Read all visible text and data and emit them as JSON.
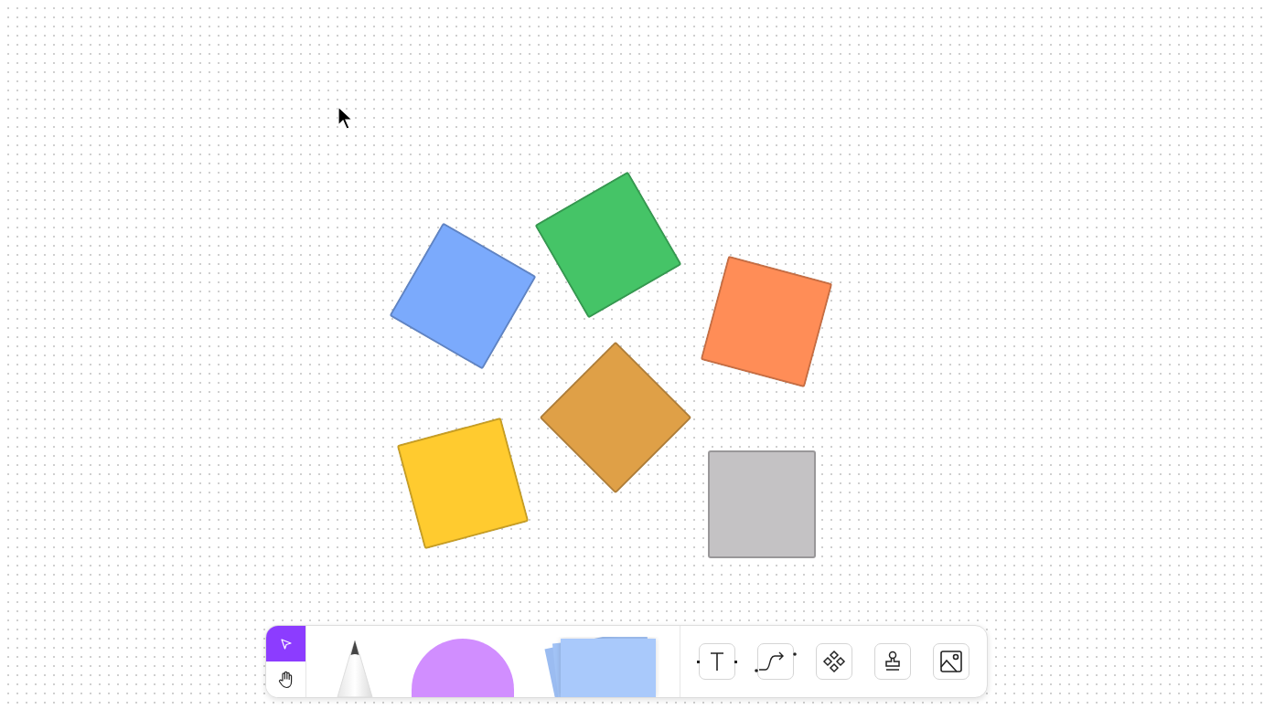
{
  "canvas": {
    "shapes": [
      {
        "color": "#7baafc"
      },
      {
        "color": "#45c467"
      },
      {
        "color": "#ff8d57"
      },
      {
        "color": "#dfa047"
      },
      {
        "color": "#ffcb2f"
      },
      {
        "color": "#c4c2c4"
      }
    ]
  },
  "toolbar": {
    "modes": [
      {
        "kind": "select",
        "selected": true
      },
      {
        "kind": "hand",
        "selected": false
      }
    ],
    "tools": [
      {
        "kind": "pen"
      },
      {
        "kind": "shape"
      },
      {
        "kind": "sticky"
      },
      {
        "kind": "text"
      },
      {
        "kind": "connector"
      },
      {
        "kind": "component"
      },
      {
        "kind": "stamp"
      },
      {
        "kind": "image"
      }
    ]
  }
}
